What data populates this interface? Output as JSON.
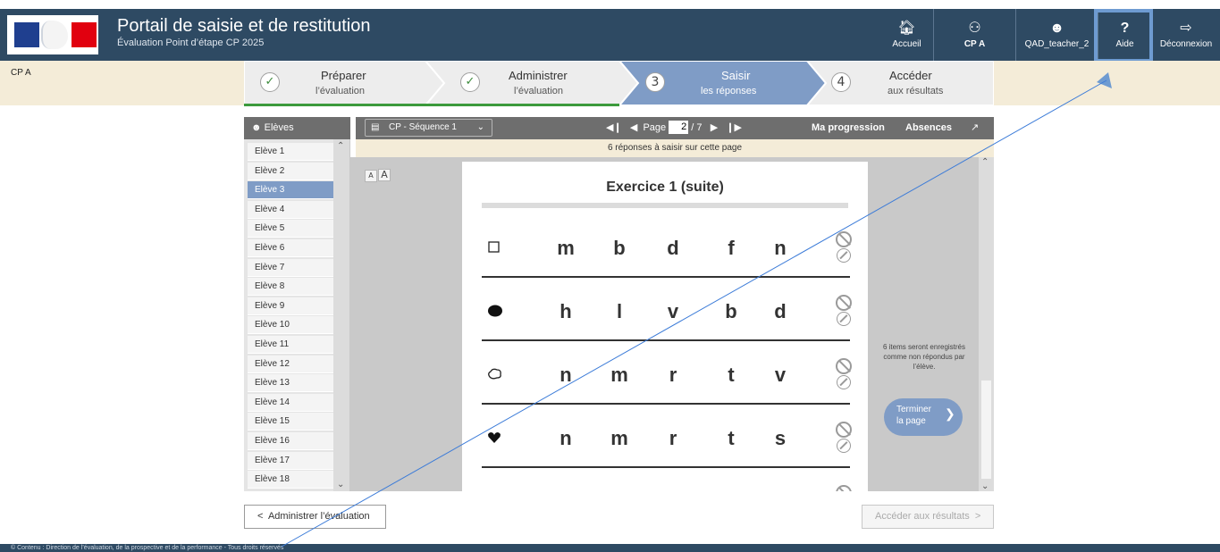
{
  "header": {
    "title": "Portail de saisie et de restitution",
    "subtitle": "Évaluation Point d’étape CP 2025",
    "nav": [
      {
        "label": "Accueil",
        "icon": "home-icon"
      },
      {
        "label": "CP A",
        "icon": "users-icon"
      },
      {
        "label": "QAD_teacher_2",
        "icon": "user-icon"
      },
      {
        "label": "Aide",
        "icon": "help-icon"
      },
      {
        "label": "Déconnexion",
        "icon": "logout-icon"
      }
    ]
  },
  "class_name": "CP A",
  "stepper": [
    {
      "title": "Préparer",
      "sub": "l’évaluation",
      "state": "done",
      "number": "✓"
    },
    {
      "title": "Administrer",
      "sub": "l’évaluation",
      "state": "done",
      "number": "✓"
    },
    {
      "title": "Saisir",
      "sub": "les réponses",
      "state": "active",
      "number": "3"
    },
    {
      "title": "Accéder",
      "sub": "aux résultats",
      "state": "todo",
      "number": "4"
    }
  ],
  "students_panel": {
    "title": "Elèves",
    "students": [
      "Elève 1",
      "Elève 2",
      "Elève 3",
      "Elève 4",
      "Elève 5",
      "Elève 6",
      "Elève 7",
      "Elève 8",
      "Elève 9",
      "Elève 10",
      "Elève 11",
      "Elève 12",
      "Elève 13",
      "Elève 14",
      "Elève 15",
      "Elève 16",
      "Elève 17",
      "Elève 18"
    ],
    "selected": "Elève 3"
  },
  "toolbar": {
    "sequence": "CP - Séquence 1",
    "page_label": "Page",
    "page_current": "2",
    "page_total": "/ 7",
    "progression": "Ma progression",
    "absences": "Absences"
  },
  "info_bar": "6 réponses à saisir sur cette page",
  "font_buttons": [
    "A",
    "A"
  ],
  "exercise": {
    "title": "Exercice 1 (suite)",
    "rows": [
      {
        "shape": "square-icon",
        "letters": [
          "m",
          "b",
          "d",
          "f",
          "n"
        ]
      },
      {
        "shape": "blob-icon",
        "letters": [
          "h",
          "l",
          "v",
          "b",
          "d"
        ]
      },
      {
        "shape": "cloud-icon",
        "letters": [
          "n",
          "m",
          "r",
          "t",
          "v"
        ]
      },
      {
        "shape": "heart-icon",
        "letters": [
          "n",
          "m",
          "r",
          "t",
          "s"
        ]
      },
      {
        "shape": "infinity-icon",
        "letters": [
          "",
          "",
          "",
          "",
          ""
        ]
      }
    ]
  },
  "side_info": "6 items seront enregistrés comme non répondus par l’élève.",
  "finish_button": {
    "line1": "Terminer",
    "line2": "la page"
  },
  "bottom_nav": {
    "back": "Administrer l’évaluation",
    "next": "Accéder aux résultats"
  },
  "footer": "© Contenu : Direction de l’évaluation, de la prospective et de la performance - Tous droits réservés",
  "colors": {
    "header": "#2e4a63",
    "accent": "#7f9cc6",
    "highlight": "#6e9bd1",
    "band": "#f4ecd8"
  }
}
